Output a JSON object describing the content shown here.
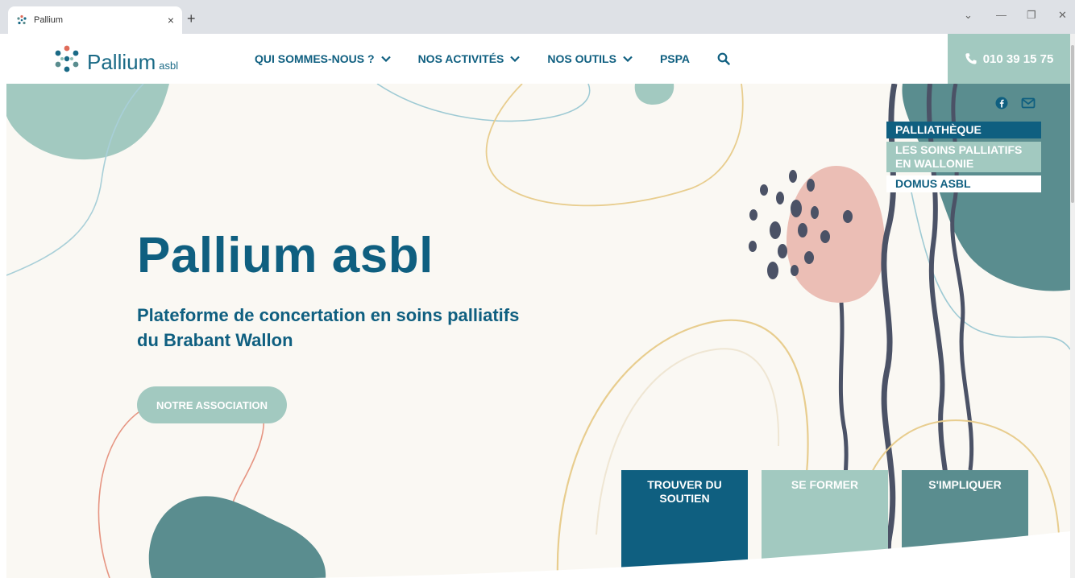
{
  "browser": {
    "tab_title": "Pallium",
    "tab_close": "×",
    "new_tab": "+",
    "window_minimize": "—",
    "window_restore": "❐",
    "window_close": "✕",
    "window_menu": "⌄"
  },
  "header": {
    "logo_name": "Pallium",
    "logo_sub": "asbl",
    "nav": {
      "about": "QUI SOMMES-NOUS ?",
      "activities": "NOS ACTIVITÉS",
      "tools": "NOS OUTILS",
      "pspa": "PSPA"
    },
    "phone": "010 39 15 75"
  },
  "hero": {
    "title": "Pallium asbl",
    "subtitle_line1": "Plateforme de concertation en soins palliatifs",
    "subtitle_line2": "du Brabant Wallon",
    "cta": "NOTRE ASSOCIATION"
  },
  "side_links": {
    "palliatheque": "PALLIATHÈQUE",
    "soins_line1": "LES SOINS PALLIATIFS",
    "soins_line2": "EN WALLONIE",
    "domus": "DOMUS ASBL"
  },
  "tiles": {
    "soutien_line1": "TROUVER DU",
    "soutien_line2": "SOUTIEN",
    "former": "SE FORMER",
    "impliquer": "S'IMPLIQUER"
  },
  "colors": {
    "primary": "#0f5f80",
    "sage": "#a2c9c0",
    "teal": "#5a8d8f",
    "pink": "#ebbeb5",
    "sand": "#e8cd8e",
    "cream": "#faf8f3"
  }
}
